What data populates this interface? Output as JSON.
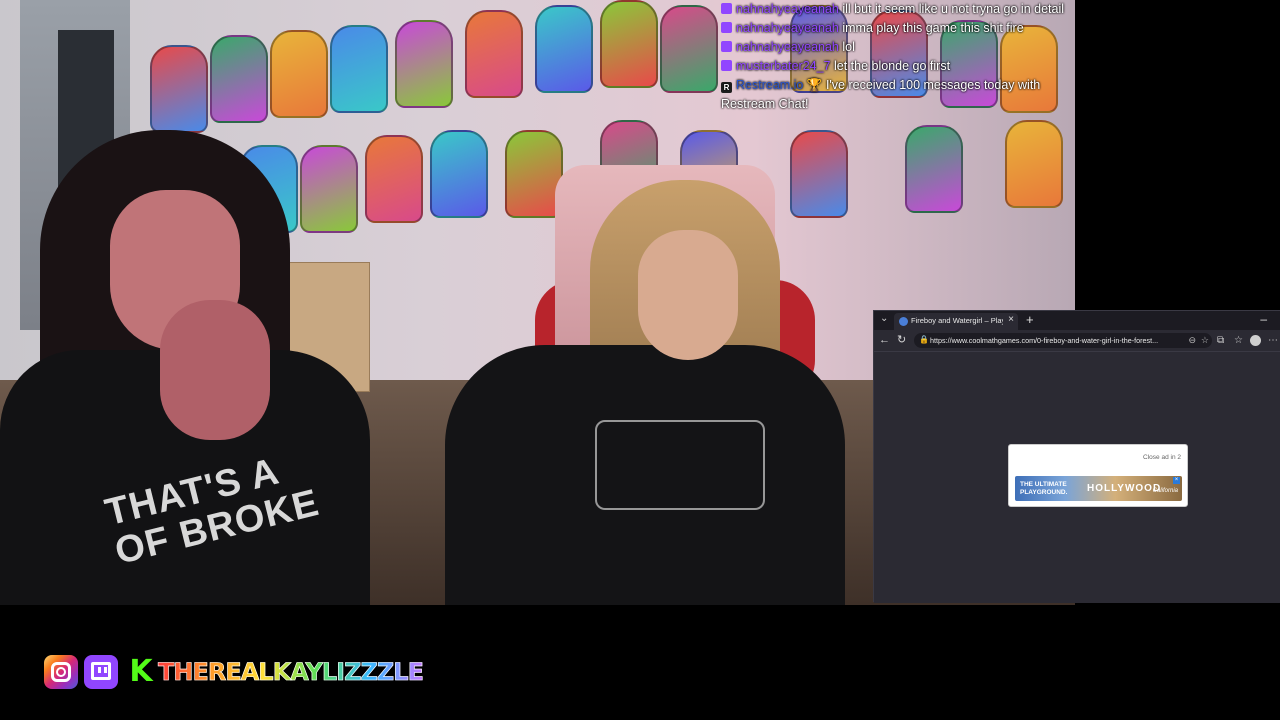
{
  "chat": {
    "messages": [
      {
        "platform": "twitch",
        "user": "nahnahyeayeanah",
        "text": "ill but it seem like u not tryna go in detail"
      },
      {
        "platform": "twitch",
        "user": "nahnahyeayeanah",
        "text": "imma play this game this shit fire"
      },
      {
        "platform": "twitch",
        "user": "nahnahyeayeanah",
        "text": "lol"
      },
      {
        "platform": "twitch",
        "user": "musterbater24_7",
        "text": "let the blonde go first"
      },
      {
        "platform": "restream",
        "user": "Restream.io",
        "badge": "R",
        "text": "I've received 100 messages today with Restream Chat!"
      }
    ]
  },
  "browser": {
    "tab_title": "Fireboy and Watergirl – Play on C...",
    "url": "https://www.coolmathgames.com/0-fireboy-and-water-girl-in-the-forest...",
    "ad": {
      "close_text": "Close ad in 2",
      "line1": "THE ULTIMATE",
      "line2": "PLAYGROUND.",
      "brand": "HOLLYWOOD",
      "tag": "California"
    }
  },
  "footer": {
    "handle": "THEREALKAYLIZZZLE",
    "icons": [
      "instagram-icon",
      "twitch-icon",
      "kick-icon"
    ]
  },
  "shirt_text": "THAT'S A\nOF BROKE",
  "colors": {
    "twitch": "#9146ff",
    "kick": "#53fc18",
    "restream_user": "#2a55cc",
    "browser_bg": "#2b2a33"
  }
}
